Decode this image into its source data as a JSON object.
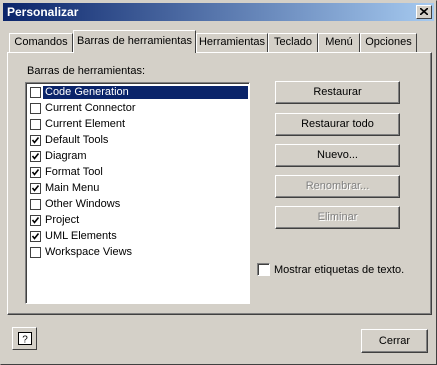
{
  "window": {
    "title": "Personalizar"
  },
  "tabs": [
    {
      "label": "Comandos"
    },
    {
      "label": "Barras de herramientas"
    },
    {
      "label": "Herramientas"
    },
    {
      "label": "Teclado"
    },
    {
      "label": "Menú"
    },
    {
      "label": "Opciones"
    }
  ],
  "active_tab": "Barras de herramientas",
  "toolbars": {
    "label": "Barras de herramientas:",
    "items": [
      {
        "label": "Code Generation",
        "checked": false,
        "selected": true
      },
      {
        "label": "Current Connector",
        "checked": false
      },
      {
        "label": "Current Element",
        "checked": false
      },
      {
        "label": "Default Tools",
        "checked": true
      },
      {
        "label": "Diagram",
        "checked": true
      },
      {
        "label": "Format Tool",
        "checked": true
      },
      {
        "label": "Main Menu",
        "checked": true
      },
      {
        "label": "Other Windows",
        "checked": false
      },
      {
        "label": "Project",
        "checked": true
      },
      {
        "label": "UML Elements",
        "checked": true
      },
      {
        "label": "Workspace Views",
        "checked": false
      }
    ]
  },
  "buttons": {
    "restaurar": "Restaurar",
    "restaurar_todo": "Restaurar todo",
    "nuevo": "Nuevo...",
    "renombrar": "Renombrar...",
    "eliminar": "Eliminar"
  },
  "show_text_labels": {
    "label": "Mostrar etiquetas de texto.",
    "checked": false
  },
  "footer": {
    "close": "Cerrar"
  },
  "icons": {
    "help": "help-icon",
    "close": "close-icon",
    "check": "check-icon"
  },
  "colors": {
    "titlebar_start": "#0a246a",
    "titlebar_end": "#a6caf0",
    "selection": "#0a246a",
    "face": "#d4d0c8"
  }
}
